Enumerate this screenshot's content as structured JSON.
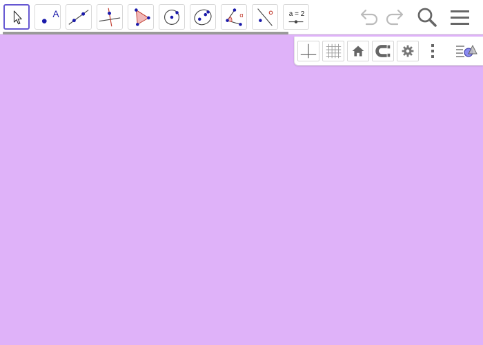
{
  "app": {
    "colors": {
      "accent": "#6557d2",
      "point": "#1a1aaa",
      "canvas_background": "#dfb2f9",
      "icon_gray": "#666666",
      "disabled_gray": "#bbbbbb"
    }
  },
  "toolbar": {
    "tools": [
      {
        "name": "move-tool",
        "icon": "arrow-cursor-icon",
        "selected": true
      },
      {
        "name": "point-tool",
        "icon": "point-icon",
        "label": "A"
      },
      {
        "name": "line-tool",
        "icon": "line-through-two-points-icon"
      },
      {
        "name": "perpendicular-line-tool",
        "icon": "perpendicular-line-icon"
      },
      {
        "name": "polygon-tool",
        "icon": "polygon-icon"
      },
      {
        "name": "circle-tool",
        "icon": "circle-with-center-icon"
      },
      {
        "name": "ellipse-tool",
        "icon": "ellipse-icon"
      },
      {
        "name": "angle-tool",
        "icon": "angle-icon",
        "label": "α"
      },
      {
        "name": "reflect-tool",
        "icon": "reflect-about-line-icon"
      },
      {
        "name": "slider-tool",
        "icon": "slider-icon",
        "label": "a = 2"
      }
    ],
    "undo": {
      "icon": "undo-icon",
      "enabled": false
    },
    "redo": {
      "icon": "redo-icon",
      "enabled": false
    },
    "search": {
      "icon": "search-icon"
    },
    "menu": {
      "icon": "hamburger-menu-icon"
    }
  },
  "style_bar": {
    "buttons": [
      {
        "name": "toggle-axes-button",
        "icon": "axes-icon"
      },
      {
        "name": "toggle-grid-button",
        "icon": "grid-icon"
      },
      {
        "name": "standard-view-button",
        "icon": "home-icon"
      },
      {
        "name": "point-capturing-button",
        "icon": "magnet-icon"
      },
      {
        "name": "graphics-settings-button",
        "icon": "gear-icon"
      }
    ],
    "more": {
      "icon": "vertical-dots-icon"
    },
    "toggle_style_bar": {
      "icon": "style-bar-toggle-icon"
    }
  }
}
